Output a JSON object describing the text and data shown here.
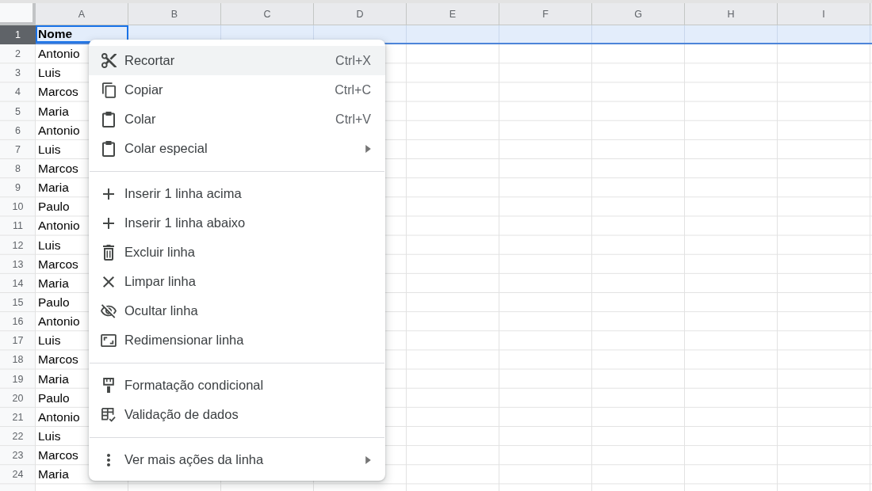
{
  "column_headers": [
    "A",
    "B",
    "C",
    "D",
    "E",
    "F",
    "G",
    "H",
    "I"
  ],
  "rows": [
    {
      "number": "1",
      "selected": true,
      "column_a": "Nome",
      "bold": true,
      "active": true
    },
    {
      "number": "2",
      "selected": false,
      "column_a": "Antonio",
      "bold": false,
      "active": false
    },
    {
      "number": "3",
      "selected": false,
      "column_a": "Luis",
      "bold": false,
      "active": false
    },
    {
      "number": "4",
      "selected": false,
      "column_a": "Marcos",
      "bold": false,
      "active": false
    },
    {
      "number": "5",
      "selected": false,
      "column_a": "Maria",
      "bold": false,
      "active": false
    },
    {
      "number": "6",
      "selected": false,
      "column_a": "Antonio",
      "bold": false,
      "active": false
    },
    {
      "number": "7",
      "selected": false,
      "column_a": "Luis",
      "bold": false,
      "active": false
    },
    {
      "number": "8",
      "selected": false,
      "column_a": "Marcos",
      "bold": false,
      "active": false
    },
    {
      "number": "9",
      "selected": false,
      "column_a": "Maria",
      "bold": false,
      "active": false
    },
    {
      "number": "10",
      "selected": false,
      "column_a": "Paulo",
      "bold": false,
      "active": false
    },
    {
      "number": "11",
      "selected": false,
      "column_a": "Antonio",
      "bold": false,
      "active": false
    },
    {
      "number": "12",
      "selected": false,
      "column_a": "Luis",
      "bold": false,
      "active": false
    },
    {
      "number": "13",
      "selected": false,
      "column_a": "Marcos",
      "bold": false,
      "active": false
    },
    {
      "number": "14",
      "selected": false,
      "column_a": "Maria",
      "bold": false,
      "active": false
    },
    {
      "number": "15",
      "selected": false,
      "column_a": "Paulo",
      "bold": false,
      "active": false
    },
    {
      "number": "16",
      "selected": false,
      "column_a": "Antonio",
      "bold": false,
      "active": false
    },
    {
      "number": "17",
      "selected": false,
      "column_a": "Luis",
      "bold": false,
      "active": false
    },
    {
      "number": "18",
      "selected": false,
      "column_a": "Marcos",
      "bold": false,
      "active": false
    },
    {
      "number": "19",
      "selected": false,
      "column_a": "Maria",
      "bold": false,
      "active": false
    },
    {
      "number": "20",
      "selected": false,
      "column_a": "Paulo",
      "bold": false,
      "active": false
    },
    {
      "number": "21",
      "selected": false,
      "column_a": "Antonio",
      "bold": false,
      "active": false
    },
    {
      "number": "22",
      "selected": false,
      "column_a": "Luis",
      "bold": false,
      "active": false
    },
    {
      "number": "23",
      "selected": false,
      "column_a": "Marcos",
      "bold": false,
      "active": false
    },
    {
      "number": "24",
      "selected": false,
      "column_a": "Maria",
      "bold": false,
      "active": false
    }
  ],
  "context_menu": {
    "groups": [
      {
        "items": [
          {
            "label": "Recortar",
            "shortcut": "Ctrl+X",
            "submenu": false,
            "highlighted": true
          },
          {
            "label": "Copiar",
            "shortcut": "Ctrl+C",
            "submenu": false,
            "highlighted": false
          },
          {
            "label": "Colar",
            "shortcut": "Ctrl+V",
            "submenu": false,
            "highlighted": false
          },
          {
            "label": "Colar especial",
            "submenu": true,
            "highlighted": false
          }
        ]
      },
      {
        "items": [
          {
            "label": "Inserir 1 linha acima",
            "submenu": false,
            "highlighted": false
          },
          {
            "label": "Inserir 1 linha abaixo",
            "submenu": false,
            "highlighted": false
          },
          {
            "label": "Excluir linha",
            "submenu": false,
            "highlighted": false
          },
          {
            "label": "Limpar linha",
            "submenu": false,
            "highlighted": false
          },
          {
            "label": "Ocultar linha",
            "submenu": false,
            "highlighted": false
          },
          {
            "label": "Redimensionar linha",
            "submenu": false,
            "highlighted": false
          }
        ]
      },
      {
        "items": [
          {
            "label": "Formatação condicional",
            "submenu": false,
            "highlighted": false
          },
          {
            "label": "Validação de dados",
            "submenu": false,
            "highlighted": false
          }
        ]
      },
      {
        "items": [
          {
            "label": "Ver mais ações da linha",
            "submenu": true,
            "highlighted": false
          }
        ]
      }
    ]
  }
}
